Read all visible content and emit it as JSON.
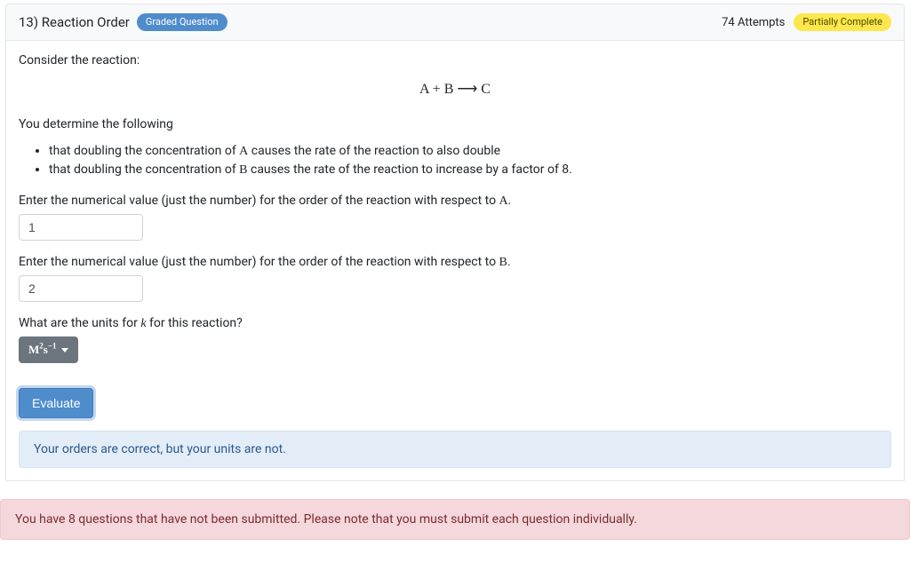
{
  "header": {
    "question_title": "13) Reaction Order",
    "graded_badge": "Graded Question",
    "attempts": "74 Attempts",
    "status_badge": "Partially Complete"
  },
  "body": {
    "intro": "Consider the reaction:",
    "equation": "A + B ⟶ C",
    "determine_line": "You determine the following",
    "bullets": [
      {
        "pre": "that doubling the concentration of ",
        "var": "A",
        "post": " causes the rate of the reaction to also double"
      },
      {
        "pre": "that doubling the concentration of ",
        "var": "B",
        "post": " causes the rate of the reaction to increase by a factor of 8."
      }
    ],
    "prompt_a": {
      "pre": "Enter the numerical value (just the number) for the order of the reaction with respect to ",
      "var": "A",
      "post": "."
    },
    "input_a": "1",
    "prompt_b": {
      "pre": "Enter the numerical value (just the number) for the order of the reaction with respect to ",
      "var": "B",
      "post": "."
    },
    "input_b": "2",
    "prompt_k": {
      "pre": "What are the units for ",
      "var": "k",
      "post": " for this reaction?"
    },
    "dropdown_selected_html": "M²s⁻¹",
    "evaluate_label": "Evaluate",
    "feedback": "Your orders are correct, but your units are not."
  },
  "footer_alert": "You have 8 questions that have not been submitted. Please note that you must submit each question individually."
}
